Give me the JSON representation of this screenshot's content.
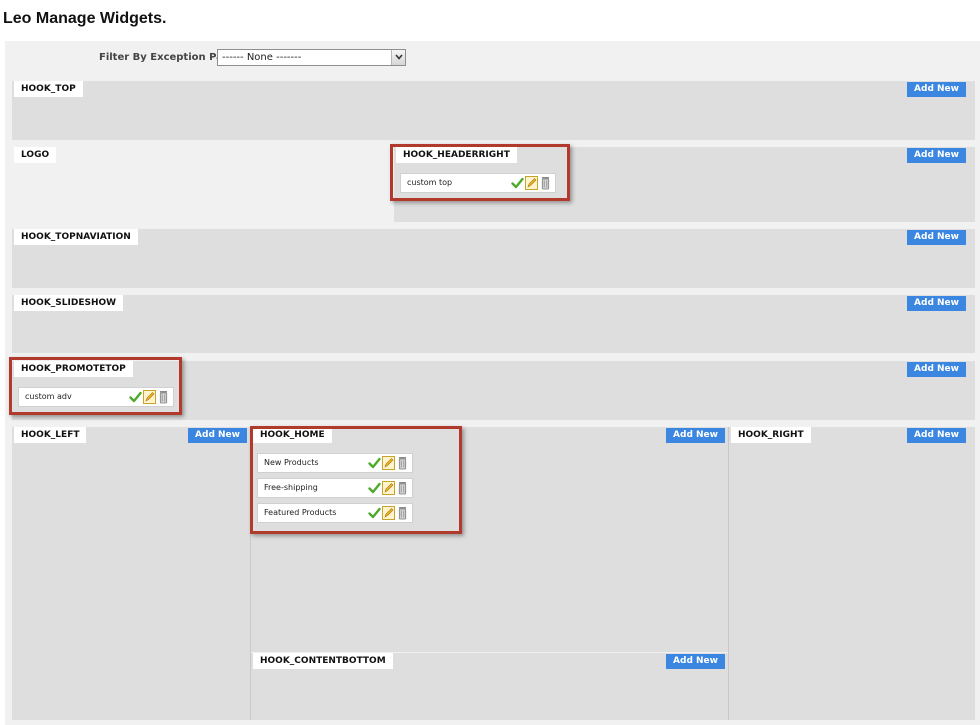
{
  "page": {
    "title": "Leo Manage Widgets."
  },
  "filter": {
    "label": "Filter By Exception Page:",
    "selected": "------ None -------"
  },
  "add_label": "Add New",
  "hooks": {
    "top": {
      "label": "HOOK_TOP"
    },
    "logo": {
      "label": "LOGO"
    },
    "headerright": {
      "label": "HOOK_HEADERRIGHT",
      "widgets": [
        "custom top"
      ]
    },
    "topnavigation": {
      "label": "HOOK_TOPNAVIATION"
    },
    "slideshow": {
      "label": "HOOK_SLIDESHOW"
    },
    "promotetop": {
      "label": "HOOK_PROMOTETOP",
      "widgets": [
        "custom adv"
      ]
    },
    "left": {
      "label": "HOOK_LEFT"
    },
    "home": {
      "label": "HOOK_HOME",
      "widgets": [
        "New Products",
        "Free-shipping",
        "Featured Products"
      ]
    },
    "right": {
      "label": "HOOK_RIGHT"
    },
    "contentbottom": {
      "label": "HOOK_CONTENTBOTTOM"
    }
  },
  "colors": {
    "add_button": "#3b86e0",
    "hook_bg": "#dedede",
    "highlight": "#b23a2c"
  },
  "icons": {
    "enable": "check-icon",
    "edit": "pencil-icon",
    "delete": "trash-icon"
  }
}
